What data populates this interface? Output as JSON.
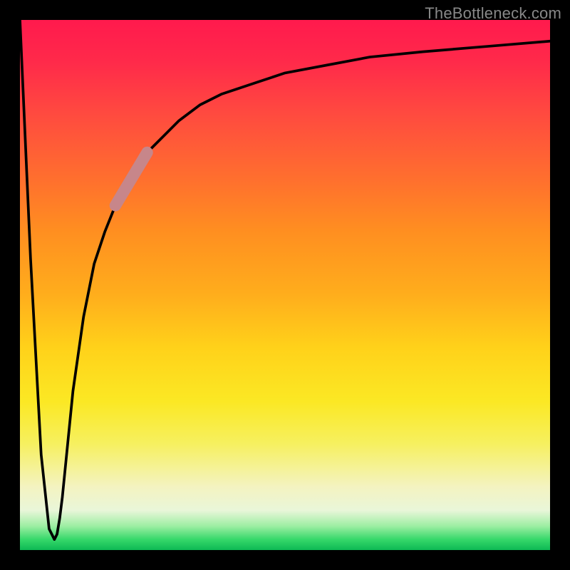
{
  "watermark": "TheBottleneck.com",
  "chart_data": {
    "type": "line",
    "title": "",
    "xlabel": "",
    "ylabel": "",
    "xlim": [
      0,
      100
    ],
    "ylim": [
      0,
      100
    ],
    "x": [
      0,
      2,
      4,
      5.5,
      6.5,
      7,
      7.5,
      8,
      9,
      10,
      12,
      14,
      16,
      18,
      20,
      22,
      24,
      27,
      30,
      34,
      38,
      44,
      50,
      58,
      66,
      76,
      88,
      100
    ],
    "values": [
      100,
      55,
      18,
      4,
      2,
      3,
      6,
      10,
      20,
      30,
      44,
      54,
      60,
      65,
      69,
      72,
      75,
      78,
      81,
      84,
      86,
      88,
      90,
      91.5,
      93,
      94,
      95,
      96
    ],
    "highlight_segment": {
      "x_start": 18,
      "x_end": 24,
      "y_start": 65,
      "y_end": 75
    },
    "gradient_stops": [
      {
        "pct": 0,
        "color": "#ff1a4d"
      },
      {
        "pct": 18,
        "color": "#ff4b3f"
      },
      {
        "pct": 40,
        "color": "#ff8f20"
      },
      {
        "pct": 62,
        "color": "#ffd21a"
      },
      {
        "pct": 80,
        "color": "#f6f060"
      },
      {
        "pct": 92.5,
        "color": "#e9f6d9"
      },
      {
        "pct": 98,
        "color": "#36d86a"
      },
      {
        "pct": 100,
        "color": "#0db954"
      }
    ]
  }
}
